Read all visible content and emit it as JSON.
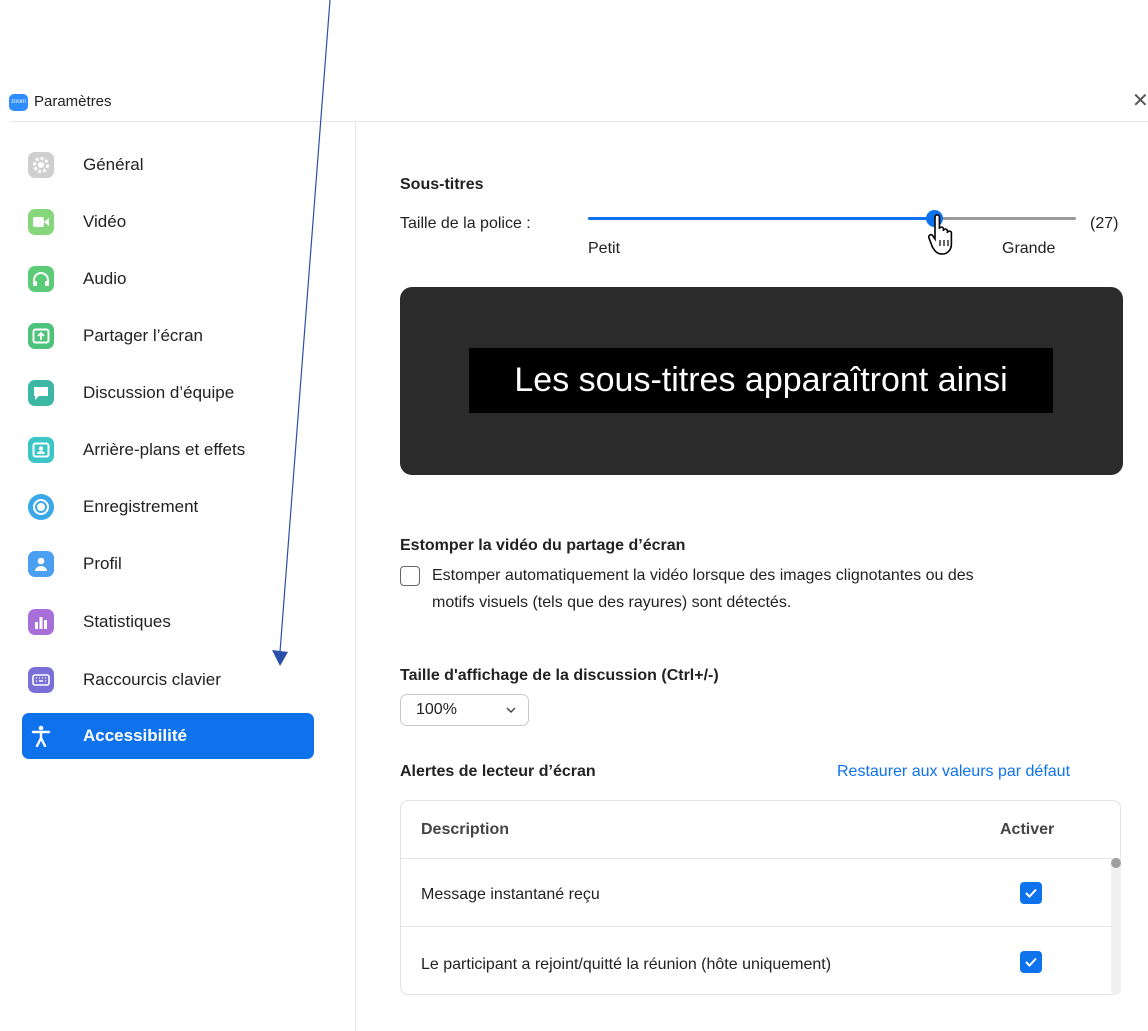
{
  "window": {
    "title": "Paramètres",
    "logo_text": "zoom",
    "close_glyph": "✕"
  },
  "sidebar": {
    "items": [
      {
        "label": "Général",
        "icon": "gear-icon",
        "color": "#cccccc"
      },
      {
        "label": "Vidéo",
        "icon": "video-camera-icon",
        "color": "#7ed27a"
      },
      {
        "label": "Audio",
        "icon": "headphones-icon",
        "color": "#5cc877"
      },
      {
        "label": "Partager l’écran",
        "icon": "share-screen-icon",
        "color": "#4cc27b"
      },
      {
        "label": "Discussion d’équipe",
        "icon": "chat-icon",
        "color": "#3bb7a3"
      },
      {
        "label": "Arrière-plans et effets",
        "icon": "background-person-icon",
        "color": "#3ac6c6"
      },
      {
        "label": "Enregistrement",
        "icon": "record-icon",
        "color": "#3aa8e8"
      },
      {
        "label": "Profil",
        "icon": "profile-icon",
        "color": "#4a9ff0"
      },
      {
        "label": "Statistiques",
        "icon": "statistics-icon",
        "color": "#a86fd8"
      },
      {
        "label": "Raccourcis clavier",
        "icon": "keyboard-icon",
        "color": "#7a6fd8"
      },
      {
        "label": "Accessibilité",
        "icon": "accessibility-icon",
        "color": "#0e72ed",
        "active": true
      }
    ]
  },
  "captions": {
    "heading": "Sous-titres",
    "font_size_label": "Taille de la police :",
    "min_label": "Petit",
    "max_label": "Grande",
    "value_display": "(27)",
    "slider_fraction": 0.71,
    "preview_text": "Les sous-titres apparaîtront ainsi"
  },
  "dim_video": {
    "heading": "Estomper la vidéo du partage d’écran",
    "checkbox_line1": "Estomper automatiquement la vidéo lorsque des images clignotantes ou des",
    "checkbox_line2": "motifs visuels (tels que des rayures) sont détectés.",
    "checked": false
  },
  "chat_size": {
    "heading": "Taille d'affichage de la discussion (Ctrl+/-)",
    "selected": "100%"
  },
  "screen_reader": {
    "heading": "Alertes de lecteur d’écran",
    "restore_link": "Restaurer aux valeurs par défaut",
    "col_description": "Description",
    "col_enable": "Activer",
    "rows": [
      {
        "description": "Message instantané reçu",
        "enabled": true
      },
      {
        "description": "Le participant a rejoint/quitté la réunion (hôte uniquement)",
        "enabled": true
      }
    ]
  },
  "colors": {
    "accent": "#0e72ed",
    "annotation_arrow": "#2a4fa8"
  }
}
